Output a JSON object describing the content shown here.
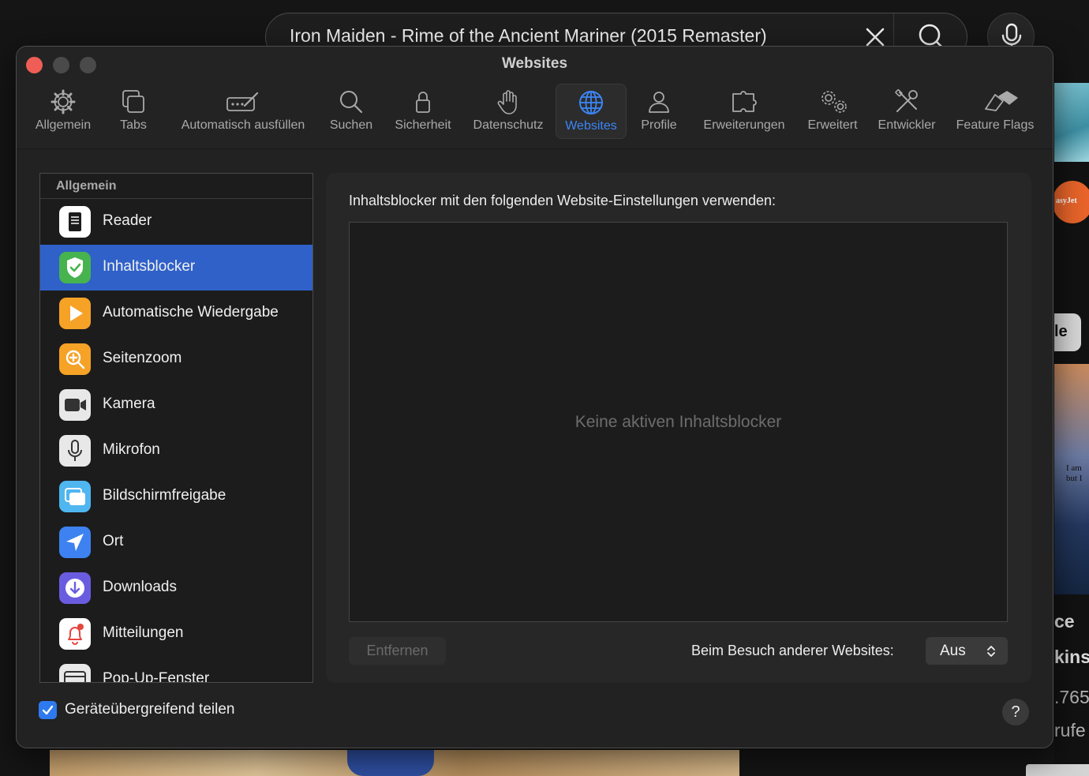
{
  "background": {
    "search_text": "Iron Maiden - Rime of the Ancient Mariner (2015 Remaster)",
    "logo_text": "asyJet",
    "chip_text": "le",
    "poster_text_1": "I am",
    "poster_text_2": "but I",
    "side_texts": [
      "ce",
      "kinse",
      ".765",
      "rufe"
    ]
  },
  "window": {
    "title": "Websites",
    "tabs": [
      {
        "label": "Allgemein",
        "icon": "gear-icon"
      },
      {
        "label": "Tabs",
        "icon": "tabs-icon"
      },
      {
        "label": "Automatisch ausfüllen",
        "icon": "autofill-icon"
      },
      {
        "label": "Suchen",
        "icon": "search-icon"
      },
      {
        "label": "Sicherheit",
        "icon": "lock-icon"
      },
      {
        "label": "Datenschutz",
        "icon": "hand-icon"
      },
      {
        "label": "Websites",
        "icon": "globe-icon",
        "active": true
      },
      {
        "label": "Profile",
        "icon": "person-icon"
      },
      {
        "label": "Erweiterungen",
        "icon": "puzzle-icon"
      },
      {
        "label": "Erweitert",
        "icon": "gears-icon"
      },
      {
        "label": "Entwickler",
        "icon": "tools-icon"
      },
      {
        "label": "Feature Flags",
        "icon": "flags-icon"
      }
    ],
    "sidebar": {
      "header": "Allgemein",
      "items": [
        {
          "label": "Reader",
          "icon": "reader-icon"
        },
        {
          "label": "Inhaltsblocker",
          "icon": "shield-check-icon",
          "selected": true
        },
        {
          "label": "Automatische Wiedergabe",
          "icon": "play-icon"
        },
        {
          "label": "Seitenzoom",
          "icon": "zoom-icon"
        },
        {
          "label": "Kamera",
          "icon": "camera-icon"
        },
        {
          "label": "Mikrofon",
          "icon": "microphone-icon"
        },
        {
          "label": "Bildschirmfreigabe",
          "icon": "screen-share-icon"
        },
        {
          "label": "Ort",
          "icon": "location-icon"
        },
        {
          "label": "Downloads",
          "icon": "download-icon"
        },
        {
          "label": "Mitteilungen",
          "icon": "bell-icon"
        },
        {
          "label": "Pop-Up-Fenster",
          "icon": "popup-window-icon"
        }
      ]
    },
    "panel": {
      "heading": "Inhaltsblocker mit den folgenden Website-Einstellungen verwenden:",
      "empty_text": "Keine aktiven Inhaltsblocker",
      "remove_label": "Entfernen",
      "visit_label": "Beim Besuch anderer Websites:",
      "visit_value": "Aus"
    },
    "footer": {
      "share_label": "Geräteübergreifend teilen",
      "share_checked": true,
      "help_label": "?"
    }
  },
  "colors": {
    "accent": "#3b86f7",
    "selection": "#2f61c9",
    "close_button": "#ee5e56"
  }
}
